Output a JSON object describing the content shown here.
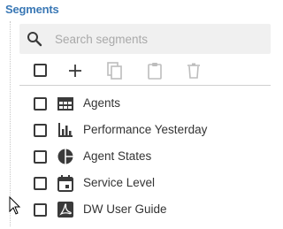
{
  "section": {
    "title": "Segments"
  },
  "search": {
    "placeholder": "Search segments",
    "value": "",
    "icon": "search-icon"
  },
  "toolbar": {
    "buttons": [
      {
        "name": "add",
        "icon": "plus-icon",
        "enabled": true
      },
      {
        "name": "copy",
        "icon": "copy-icon",
        "enabled": false
      },
      {
        "name": "paste",
        "icon": "clipboard-icon",
        "enabled": false
      },
      {
        "name": "delete",
        "icon": "trash-icon",
        "enabled": false
      }
    ]
  },
  "segments": [
    {
      "label": "Agents",
      "icon": "table-icon",
      "checked": false
    },
    {
      "label": "Performance Yesterday",
      "icon": "bar-chart-icon",
      "checked": false
    },
    {
      "label": "Agent States",
      "icon": "pie-chart-icon",
      "checked": false
    },
    {
      "label": "Service Level",
      "icon": "calendar-icon",
      "checked": false
    },
    {
      "label": "DW User Guide",
      "icon": "pdf-icon",
      "checked": false
    }
  ],
  "colors": {
    "title": "#3a78b5",
    "search_bg": "#f0f0f0",
    "icon_dark": "#3a3a3a",
    "icon_disabled": "#bdbdbd",
    "text": "#333333"
  }
}
